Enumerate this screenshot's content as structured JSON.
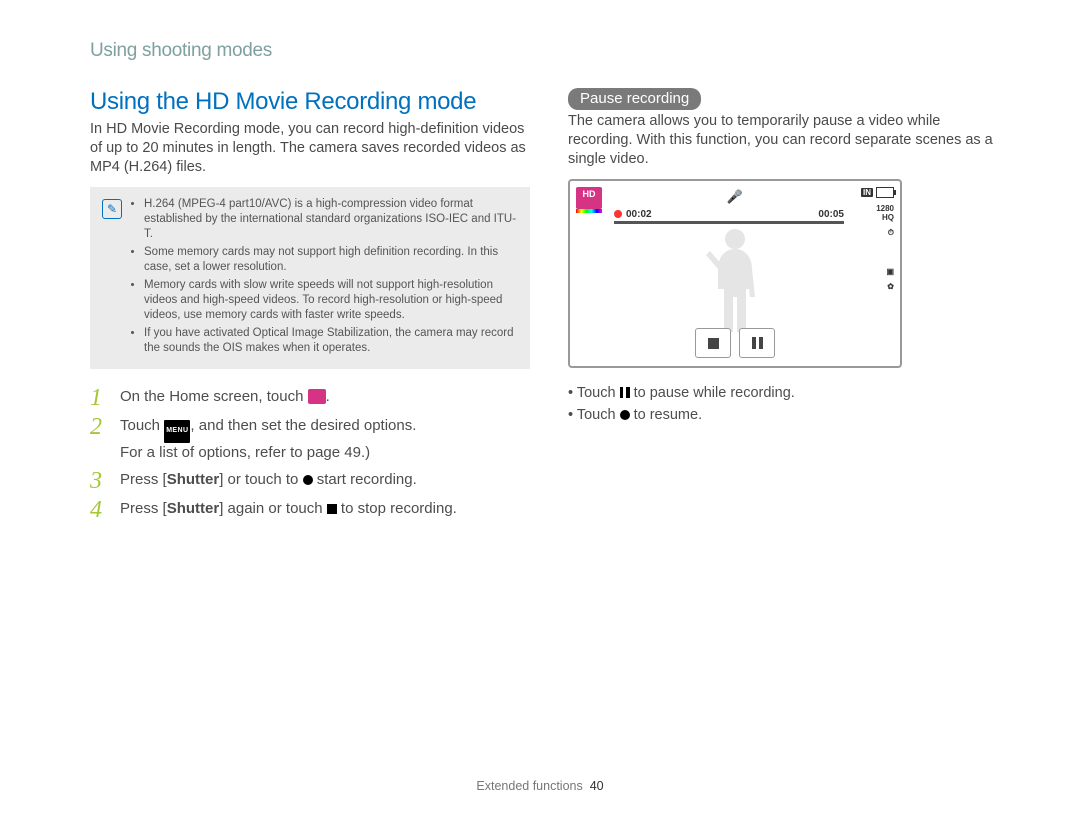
{
  "breadcrumb": "Using shooting modes",
  "title": "Using the HD Movie Recording mode",
  "intro": "In HD Movie Recording mode, you can record high-definition videos of up to 20 minutes in length. The camera saves recorded videos as MP4 (H.264) files.",
  "note_icon_label": "✎",
  "notes": [
    "H.264 (MPEG-4 part10/AVC) is a high-compression video format established by the international standard organizations ISO-IEC and ITU-T.",
    "Some memory cards may not support high definition recording. In this case, set a lower resolution.",
    "Memory cards with slow write speeds will not support high-resolution videos and high-speed videos. To record high-resolution or high-speed videos, use memory cards with faster write speeds.",
    "If you have activated Optical Image Stabilization, the camera may record the sounds the OIS makes when it operates."
  ],
  "steps": {
    "s1_pre": "On the Home screen, touch ",
    "s1_post": ".",
    "s2_pre": "Touch ",
    "s2_mid": ", and then set the desired options. ",
    "s2_sub": "For a list of options, refer to page 49.)",
    "s3_pre": "Press [",
    "s3_btn": "Shutter",
    "s3_mid": "] or touch to ",
    "s3_post": " start recording.",
    "s4_pre": "Press [",
    "s4_btn": "Shutter",
    "s4_mid": "] again or touch ",
    "s4_post": " to stop recording."
  },
  "pill": "Pause recording",
  "pill_body": "The camera allows you to temporarily pause a video while recording. With this function, you can record separate scenes as a single video.",
  "display": {
    "hd": "HD",
    "mic": "🎤",
    "time_left": "00:02",
    "time_right": "00:05",
    "in_badge": "IN",
    "res_top": "1280",
    "res_bot": "HQ"
  },
  "bullets": {
    "b1_pre": "Touch ",
    "b1_post": " to pause while recording.",
    "b2_pre": "Touch ",
    "b2_post": " to resume."
  },
  "menu_label": "MENU",
  "footer_text": "Extended functions",
  "footer_page": "40"
}
